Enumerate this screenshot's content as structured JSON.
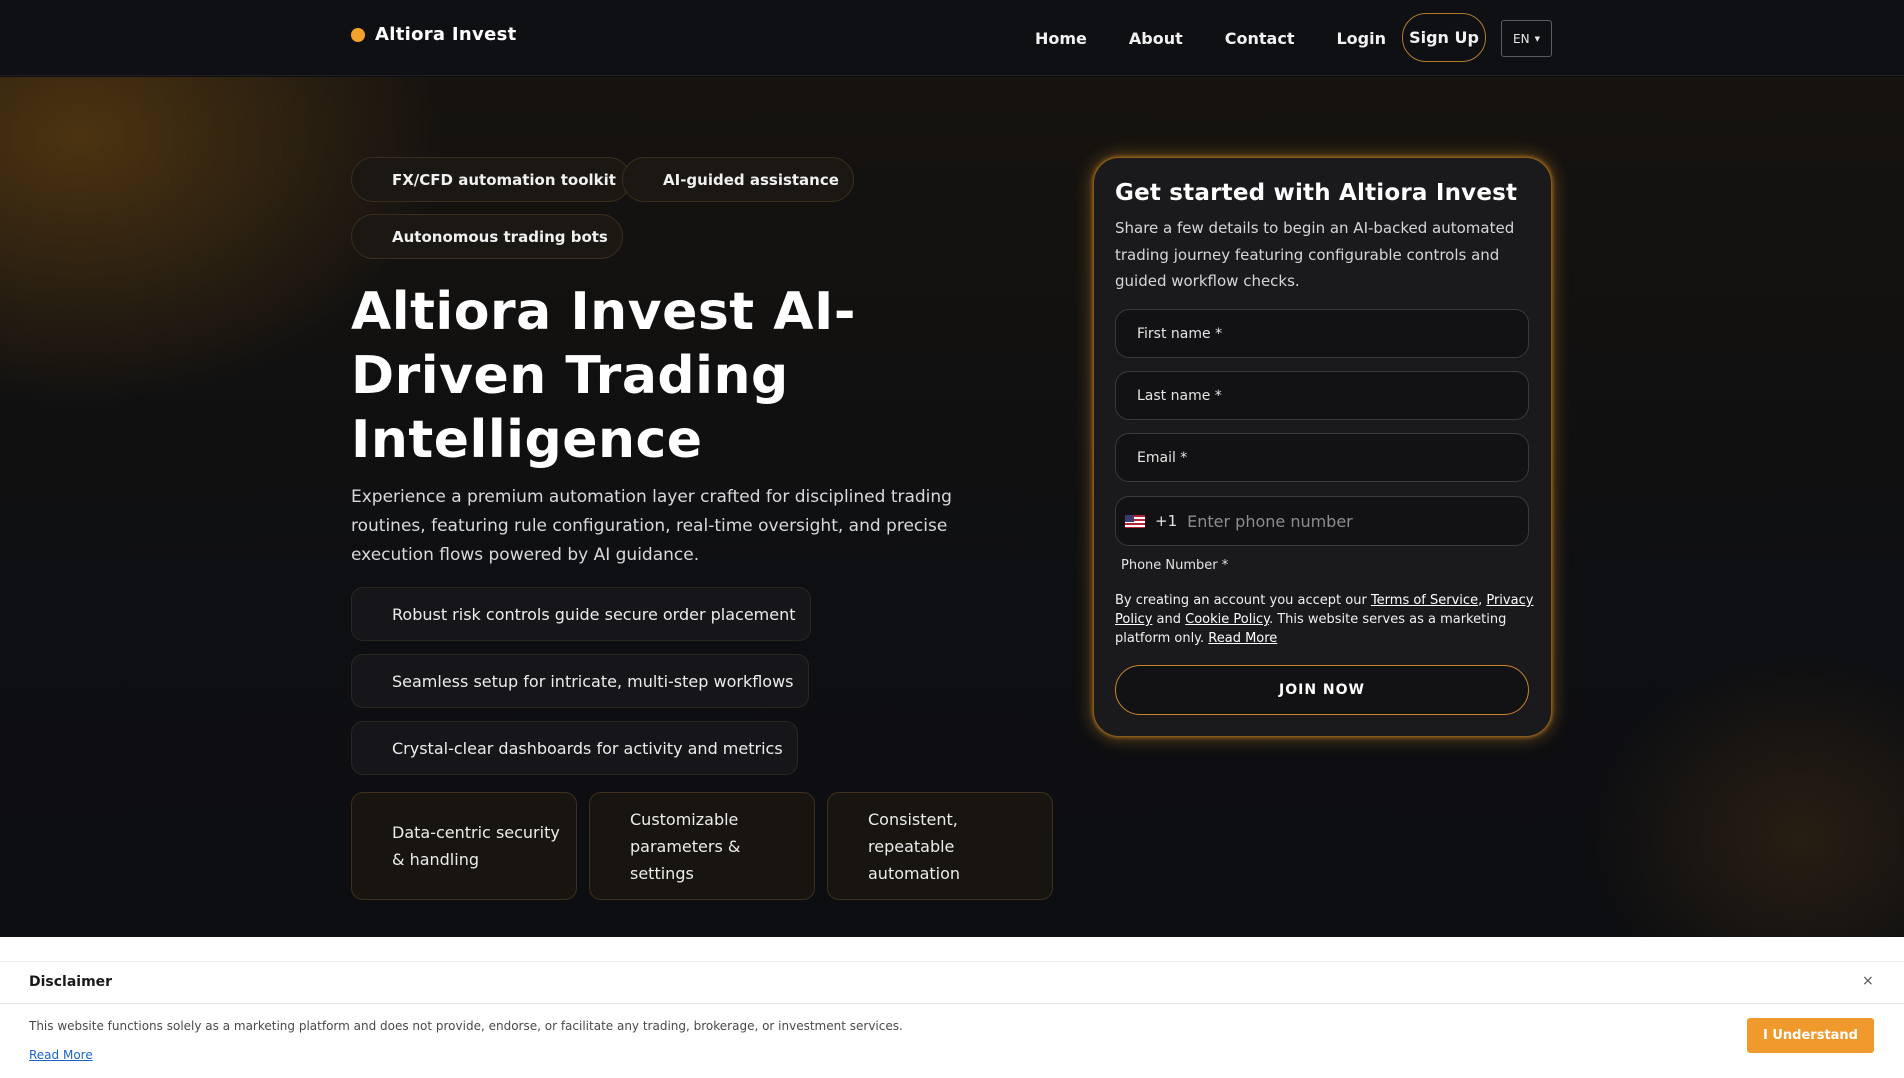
{
  "nav": {
    "brand": "Altiora Invest",
    "links": [
      "Home",
      "About",
      "Contact",
      "Login"
    ],
    "signup": "Sign Up",
    "language": "EN"
  },
  "hero": {
    "pills": [
      "FX/CFD automation toolkit",
      "AI-guided assistance",
      "Autonomous trading bots"
    ],
    "headline": "Altiora Invest AI-Driven Trading Intelligence",
    "lead": "Experience a premium automation layer crafted for disciplined trading routines, featuring rule configuration, real-time oversight, and precise execution flows powered by AI guidance.",
    "features": [
      "Robust risk controls guide secure order placement",
      "Seamless setup for intricate, multi-step workflows",
      "Crystal-clear dashboards for activity and metrics"
    ],
    "cards": [
      "Data-centric security & handling",
      "Customizable parameters & settings",
      "Consistent, repeatable automation"
    ]
  },
  "form": {
    "title": "Get started with Altiora Invest",
    "subtitle": "Share a few details to begin an AI-backed automated trading journey featuring configurable controls and guided workflow checks.",
    "first_name": "First name *",
    "last_name": "Last name *",
    "email": "Email *",
    "dial_code": "+1",
    "phone_placeholder": "Enter phone number",
    "phone_label": "Phone Number *",
    "legal": {
      "prefix": "By creating an account you accept our ",
      "terms": "Terms of Service",
      "comma": ",",
      "privacy": "Privacy Policy",
      "and": " and ",
      "cookie": "Cookie Policy",
      "suffix": ". This website serves as a marketing platform only. ",
      "read_more": "Read More"
    },
    "join": "JOIN NOW"
  },
  "disclaimer": {
    "title": "Disclaimer",
    "close": "×",
    "text": "This website functions solely as a marketing platform and does not provide, endorse, or facilitate any trading, brokerage, or investment services.",
    "read_more": "Read More",
    "button": "I Understand"
  },
  "colors": {
    "accent": "#f3a12a",
    "button_orange": "#f09a2e",
    "background": "#0d0e11"
  }
}
